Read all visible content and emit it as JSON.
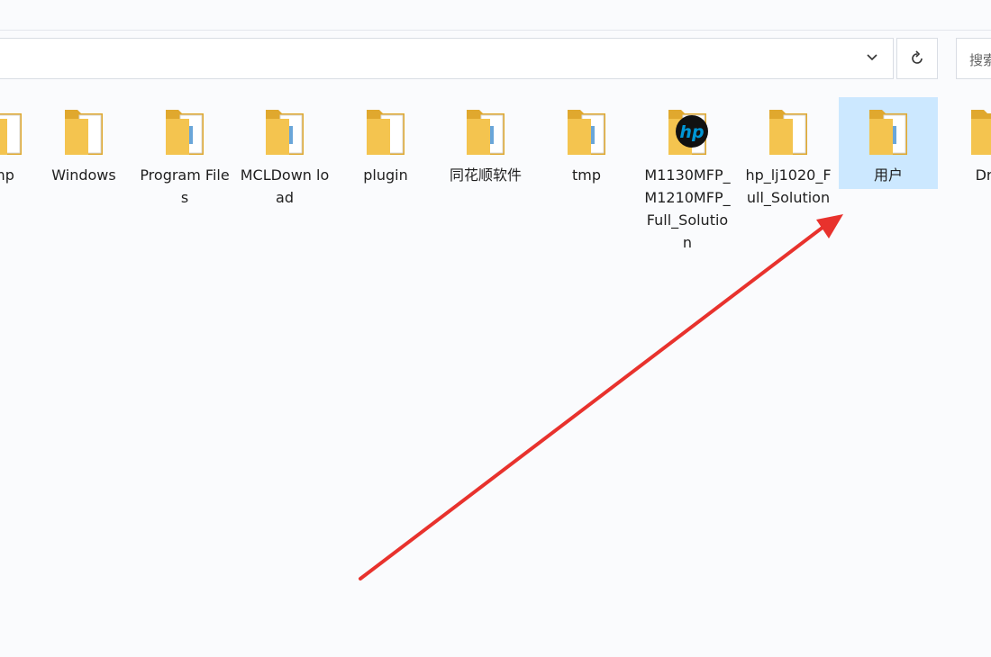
{
  "toolbar": {
    "address_value": "",
    "search_placeholder": "搜索"
  },
  "files": [
    {
      "label": "mp",
      "icon": "folder-icon"
    },
    {
      "label": "Windows",
      "icon": "folder-icon"
    },
    {
      "label": "Program Files",
      "icon": "folder-icon"
    },
    {
      "label": "MCLDown load",
      "icon": "folder-icon"
    },
    {
      "label": "plugin",
      "icon": "folder-icon"
    },
    {
      "label": "同花顺软件",
      "icon": "folder-icon"
    },
    {
      "label": "tmp",
      "icon": "folder-icon"
    },
    {
      "label": "M1130MFP_M1210MFP_Full_Solution",
      "icon": "hp-folder-icon"
    },
    {
      "label": "hp_lj1020_Full_Solution",
      "icon": "folder-icon"
    },
    {
      "label": "用户",
      "icon": "folder-icon",
      "selected": true
    },
    {
      "label": "Driv",
      "icon": "folder-icon"
    }
  ],
  "colors": {
    "selection": "#cce8ff",
    "arrow": "#e8322d",
    "folder": "#f4c44f"
  }
}
